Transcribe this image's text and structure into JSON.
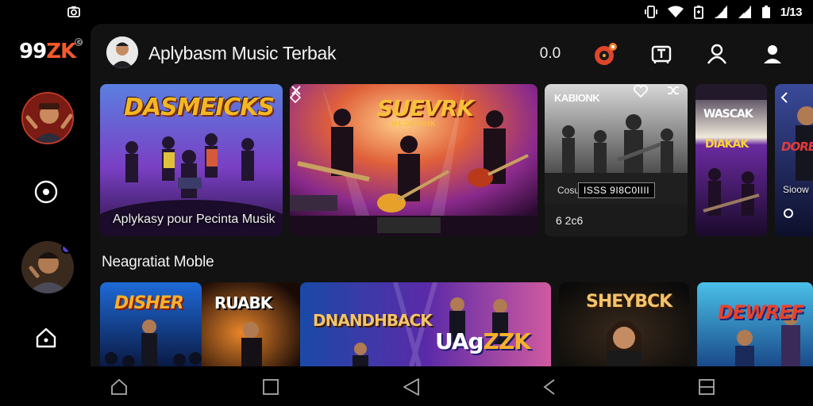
{
  "status_bar": {
    "time": "1/13"
  },
  "app": {
    "logo_main": "99",
    "logo_accent": "ZK",
    "logo_mark": "©"
  },
  "header": {
    "title": "Aplybasm Music Terbak",
    "counter": "0.0"
  },
  "featured": {
    "cards": [
      {
        "poster": "DASMEICKS",
        "caption": "Aplykasy pour Pecinta Musik"
      },
      {
        "poster": "SUEVRK",
        "subtitle": "MEOKSUIK"
      },
      {
        "label": "KABIONK",
        "tag_prefix": "Cosu",
        "tag": "ISSS 9I8C0IIII",
        "duration": "6 2c6"
      },
      {
        "poster_a": "WASCAK",
        "poster_b": "DIAKAK"
      },
      {
        "poster": "Dore",
        "caption": "Sioow"
      }
    ]
  },
  "section": {
    "title": "Neagratiat Moble"
  },
  "row2": {
    "cards": [
      {
        "poster": "Disher"
      },
      {
        "poster": "RUABK"
      },
      {
        "poster": "DNANDHBACK",
        "poster2_a": "UAg",
        "poster2_b": "ZZK"
      },
      {
        "poster": "SHEYBCK"
      },
      {
        "poster": "DEWREF"
      }
    ]
  },
  "colors": {
    "accent": "#f25a2b",
    "panel": "#121212",
    "background": "#000000"
  }
}
